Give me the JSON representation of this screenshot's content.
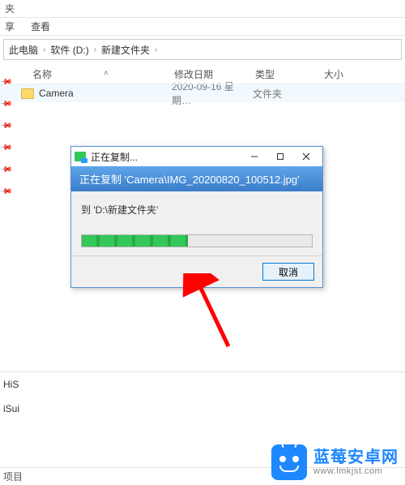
{
  "window_title_suffix": "夹",
  "menu": {
    "share": "享",
    "view": "查看"
  },
  "breadcrumb": {
    "this_pc": "此电脑",
    "drive": "软件 (D:)",
    "folder": "新建文件夹"
  },
  "columns": {
    "name": "名称",
    "date": "修改日期",
    "type": "类型",
    "size": "大小"
  },
  "rows": [
    {
      "name": "Camera",
      "date": "2020-09-16 星期…",
      "type": "文件夹",
      "size": ""
    }
  ],
  "lower_items": [
    "HiS",
    "iSui"
  ],
  "status": "项目",
  "dialog": {
    "title": "正在复制...",
    "header": "正在复制 'Camera\\IMG_20200820_100512.jpg'",
    "dest": "到 'D:\\新建文件夹'",
    "progress_percent": 46,
    "cancel": "取消"
  },
  "watermark": {
    "main": "蓝莓安卓网",
    "sub": "www.lmkjst.com"
  }
}
